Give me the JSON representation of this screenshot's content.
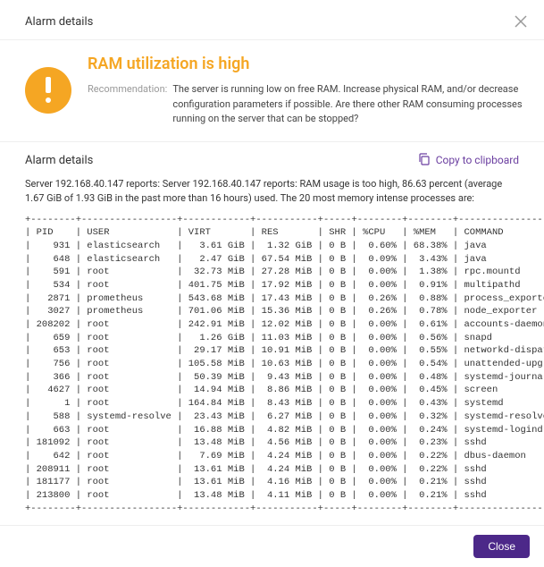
{
  "header": {
    "title": "Alarm details"
  },
  "hero": {
    "title": "RAM utilization is high",
    "recommendation_label": "Recommendation:",
    "recommendation_text": "The server is running low on free RAM. Increase physical RAM, and/or decrease configuration parameters if possible. Are there other RAM consuming processes running on the server that can be stopped?"
  },
  "details": {
    "title": "Alarm details",
    "copy_label": "Copy to clipboard",
    "intro": "Server 192.168.40.147 reports: Server 192.168.40.147 reports: RAM usage is too high, 86.63 percent (average 1.67 GiB of 1.93 GiB in the past more than 16 hours) used. The 20 most memory intense processes are:"
  },
  "table": {
    "headers": [
      "PID",
      "USER",
      "VIRT",
      "RES",
      "SHR",
      "%CPU",
      "%MEM",
      "COMMAND"
    ],
    "rows": [
      {
        "pid": "931",
        "user": "elasticsearch",
        "virt": "3.61 GiB",
        "res": "1.32 GiB",
        "shr": "0 B",
        "cpu": "0.60%",
        "mem": "68.38%",
        "cmd": "java"
      },
      {
        "pid": "648",
        "user": "elasticsearch",
        "virt": "2.47 GiB",
        "res": "67.54 MiB",
        "shr": "0 B",
        "cpu": "0.09%",
        "mem": "3.43%",
        "cmd": "java"
      },
      {
        "pid": "591",
        "user": "root",
        "virt": "32.73 MiB",
        "res": "27.28 MiB",
        "shr": "0 B",
        "cpu": "0.00%",
        "mem": "1.38%",
        "cmd": "rpc.mountd"
      },
      {
        "pid": "534",
        "user": "root",
        "virt": "401.75 MiB",
        "res": "17.92 MiB",
        "shr": "0 B",
        "cpu": "0.00%",
        "mem": "0.91%",
        "cmd": "multipathd"
      },
      {
        "pid": "2871",
        "user": "prometheus",
        "virt": "543.68 MiB",
        "res": "17.43 MiB",
        "shr": "0 B",
        "cpu": "0.26%",
        "mem": "0.88%",
        "cmd": "process_exporte"
      },
      {
        "pid": "3027",
        "user": "prometheus",
        "virt": "701.06 MiB",
        "res": "15.36 MiB",
        "shr": "0 B",
        "cpu": "0.26%",
        "mem": "0.78%",
        "cmd": "node_exporter"
      },
      {
        "pid": "208202",
        "user": "root",
        "virt": "242.91 MiB",
        "res": "12.02 MiB",
        "shr": "0 B",
        "cpu": "0.00%",
        "mem": "0.61%",
        "cmd": "accounts-daemon"
      },
      {
        "pid": "659",
        "user": "root",
        "virt": "1.26 GiB",
        "res": "11.03 MiB",
        "shr": "0 B",
        "cpu": "0.00%",
        "mem": "0.56%",
        "cmd": "snapd"
      },
      {
        "pid": "653",
        "user": "root",
        "virt": "29.17 MiB",
        "res": "10.91 MiB",
        "shr": "0 B",
        "cpu": "0.00%",
        "mem": "0.55%",
        "cmd": "networkd-dispat"
      },
      {
        "pid": "756",
        "user": "root",
        "virt": "105.58 MiB",
        "res": "10.63 MiB",
        "shr": "0 B",
        "cpu": "0.00%",
        "mem": "0.54%",
        "cmd": "unattended-upgr"
      },
      {
        "pid": "366",
        "user": "root",
        "virt": "50.39 MiB",
        "res": "9.43 MiB",
        "shr": "0 B",
        "cpu": "0.00%",
        "mem": "0.48%",
        "cmd": "systemd-journal"
      },
      {
        "pid": "4627",
        "user": "root",
        "virt": "14.94 MiB",
        "res": "8.86 MiB",
        "shr": "0 B",
        "cpu": "0.00%",
        "mem": "0.45%",
        "cmd": "screen"
      },
      {
        "pid": "1",
        "user": "root",
        "virt": "164.84 MiB",
        "res": "8.43 MiB",
        "shr": "0 B",
        "cpu": "0.00%",
        "mem": "0.43%",
        "cmd": "systemd"
      },
      {
        "pid": "588",
        "user": "systemd-resolve",
        "virt": "23.43 MiB",
        "res": "6.27 MiB",
        "shr": "0 B",
        "cpu": "0.00%",
        "mem": "0.32%",
        "cmd": "systemd-resolve"
      },
      {
        "pid": "663",
        "user": "root",
        "virt": "16.88 MiB",
        "res": "4.82 MiB",
        "shr": "0 B",
        "cpu": "0.00%",
        "mem": "0.24%",
        "cmd": "systemd-logind"
      },
      {
        "pid": "181092",
        "user": "root",
        "virt": "13.48 MiB",
        "res": "4.56 MiB",
        "shr": "0 B",
        "cpu": "0.00%",
        "mem": "0.23%",
        "cmd": "sshd"
      },
      {
        "pid": "642",
        "user": "root",
        "virt": "7.69 MiB",
        "res": "4.24 MiB",
        "shr": "0 B",
        "cpu": "0.00%",
        "mem": "0.22%",
        "cmd": "dbus-daemon"
      },
      {
        "pid": "208911",
        "user": "root",
        "virt": "13.61 MiB",
        "res": "4.24 MiB",
        "shr": "0 B",
        "cpu": "0.00%",
        "mem": "0.22%",
        "cmd": "sshd"
      },
      {
        "pid": "181177",
        "user": "root",
        "virt": "13.61 MiB",
        "res": "4.16 MiB",
        "shr": "0 B",
        "cpu": "0.00%",
        "mem": "0.21%",
        "cmd": "sshd"
      },
      {
        "pid": "213800",
        "user": "root",
        "virt": "13.48 MiB",
        "res": "4.11 MiB",
        "shr": "0 B",
        "cpu": "0.00%",
        "mem": "0.21%",
        "cmd": "sshd"
      }
    ]
  },
  "footer": {
    "close_label": "Close"
  }
}
